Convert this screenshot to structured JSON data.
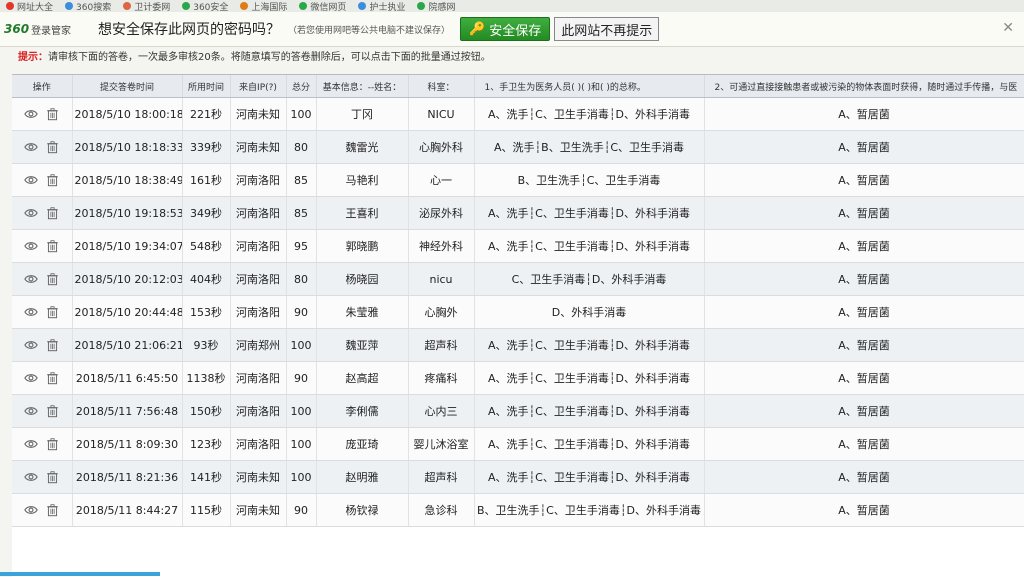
{
  "bookmarks": [
    "网址大全",
    "360搜索",
    "卫计委网",
    "360安全",
    "上海国际",
    "微信网页",
    "护士执业",
    "院感网"
  ],
  "pw_bar": {
    "brand_logo": "360",
    "brand_name": "登录管家",
    "question": "想安全保存此网页的密码吗？",
    "hint": "（若您使用网吧等公共电脑不建议保存）",
    "save_label": "安全保存",
    "never_label": "此网站不再提示"
  },
  "notice": {
    "tip": "提示：",
    "text": "请审核下面的答卷，一次最多审核20条。将随意填写的答卷删除后，可以点击下面的批量通过按钮。"
  },
  "table": {
    "headers": [
      "操作",
      "提交答卷时间",
      "所用时间",
      "来自IP(?)",
      "总分",
      "基本信息：--姓名：",
      "科室：",
      "1、手卫生为医务人员( )( )和( )的总称。",
      "2、可通过直接接触患者或被污染的物体表面时获得，随时通过手传播，与医"
    ],
    "rows": [
      [
        "2018/5/10 18:00:18",
        "221秒",
        "河南未知",
        "100",
        "丁冈",
        "NICU",
        "A、洗手┆C、卫生手消毒┆D、外科手消毒",
        "A、暂居菌"
      ],
      [
        "2018/5/10 18:18:33",
        "339秒",
        "河南未知",
        "80",
        "魏雷光",
        "心胸外科",
        "A、洗手┆B、卫生洗手┆C、卫生手消毒",
        "A、暂居菌"
      ],
      [
        "2018/5/10 18:38:49",
        "161秒",
        "河南洛阳",
        "85",
        "马艳利",
        "心一",
        "B、卫生洗手┆C、卫生手消毒",
        "A、暂居菌"
      ],
      [
        "2018/5/10 19:18:53",
        "349秒",
        "河南洛阳",
        "85",
        "王喜利",
        "泌尿外科",
        "A、洗手┆C、卫生手消毒┆D、外科手消毒",
        "A、暂居菌"
      ],
      [
        "2018/5/10 19:34:07",
        "548秒",
        "河南洛阳",
        "95",
        "郭晓鹏",
        "神经外科",
        "A、洗手┆C、卫生手消毒┆D、外科手消毒",
        "A、暂居菌"
      ],
      [
        "2018/5/10 20:12:03",
        "404秒",
        "河南洛阳",
        "80",
        "杨晓园",
        "nicu",
        "C、卫生手消毒┆D、外科手消毒",
        "A、暂居菌"
      ],
      [
        "2018/5/10 20:44:48",
        "153秒",
        "河南洛阳",
        "90",
        "朱莹雅",
        "心胸外",
        "D、外科手消毒",
        "A、暂居菌"
      ],
      [
        "2018/5/10 21:06:21",
        "93秒",
        "河南郑州",
        "100",
        "魏亚萍",
        "超声科",
        "A、洗手┆C、卫生手消毒┆D、外科手消毒",
        "A、暂居菌"
      ],
      [
        "2018/5/11 6:45:50",
        "1138秒",
        "河南洛阳",
        "90",
        "赵高超",
        "疼痛科",
        "A、洗手┆C、卫生手消毒┆D、外科手消毒",
        "A、暂居菌"
      ],
      [
        "2018/5/11 7:56:48",
        "150秒",
        "河南洛阳",
        "100",
        "李俐儒",
        "心内三",
        "A、洗手┆C、卫生手消毒┆D、外科手消毒",
        "A、暂居菌"
      ],
      [
        "2018/5/11 8:09:30",
        "123秒",
        "河南洛阳",
        "100",
        "庞亚琦",
        "婴儿沐浴室",
        "A、洗手┆C、卫生手消毒┆D、外科手消毒",
        "A、暂居菌"
      ],
      [
        "2018/5/11 8:21:36",
        "141秒",
        "河南未知",
        "100",
        "赵明雅",
        "超声科",
        "A、洗手┆C、卫生手消毒┆D、外科手消毒",
        "A、暂居菌"
      ],
      [
        "2018/5/11 8:44:27",
        "115秒",
        "河南未知",
        "90",
        "杨钦禄",
        "急诊科",
        "B、卫生洗手┆C、卫生手消毒┆D、外科手消毒",
        "A、暂居菌"
      ]
    ]
  },
  "colors": {
    "save_green": "#2b9a2b",
    "tip_red": "#dd2222",
    "header_bg": "#e7ebef"
  },
  "icons": [
    "eye-icon",
    "trash-icon",
    "close-icon"
  ]
}
